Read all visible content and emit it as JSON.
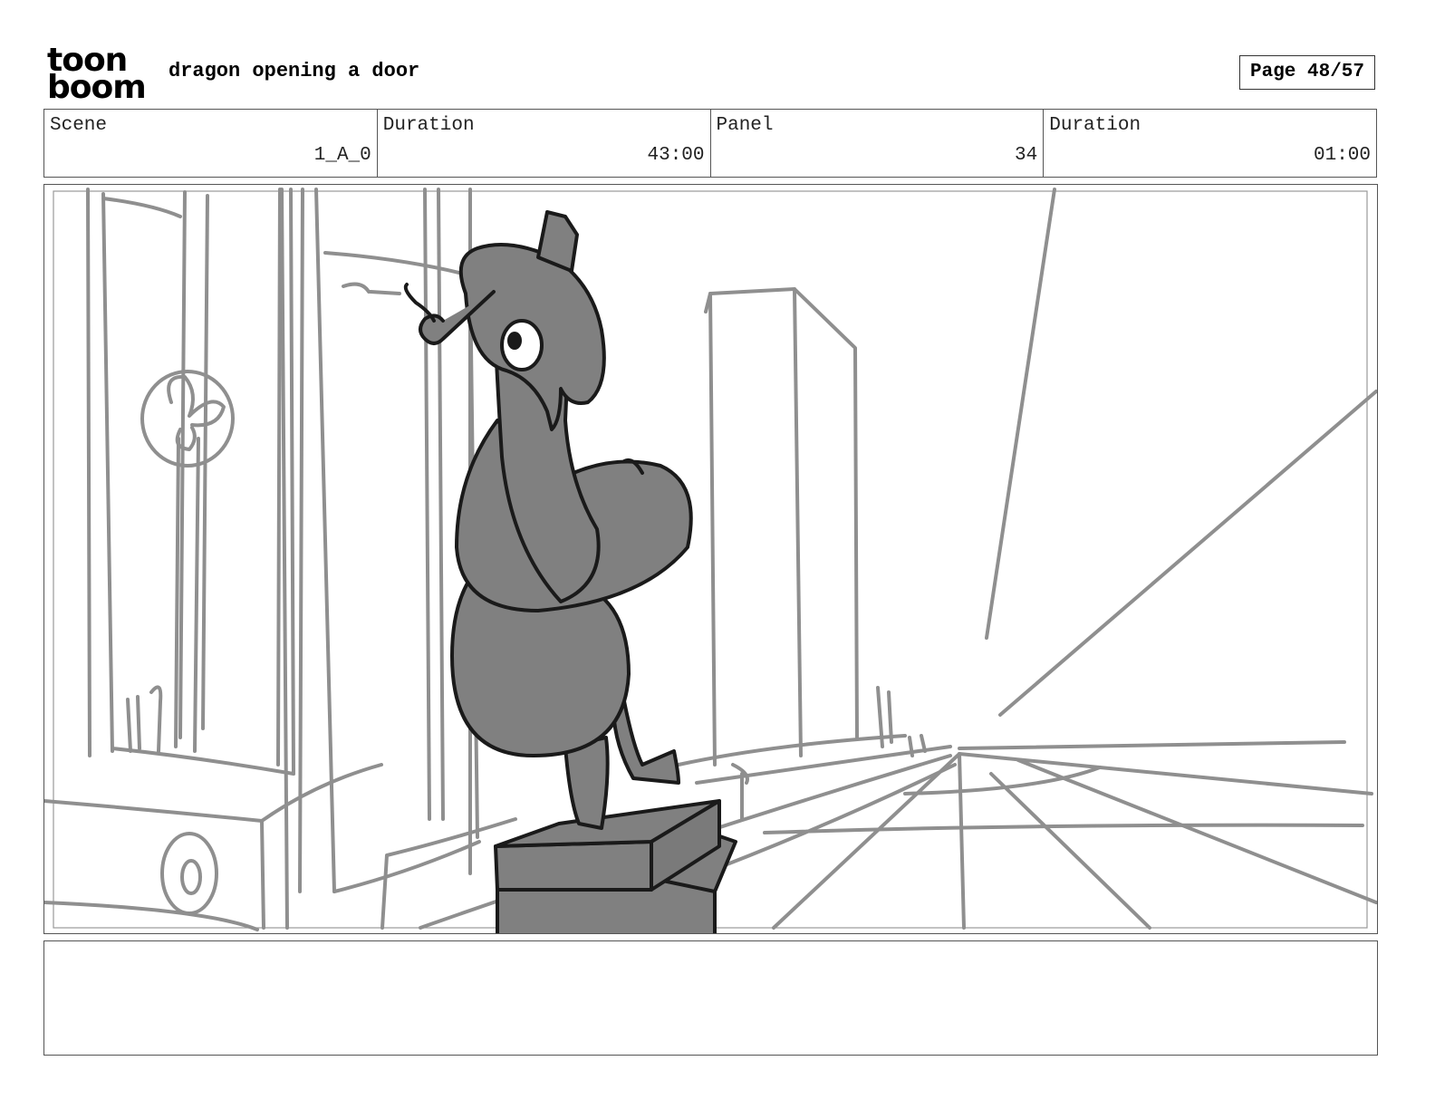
{
  "header": {
    "logo_line1": "toon",
    "logo_line2": "boom",
    "title": "dragon opening a door",
    "page": "Page 48/57"
  },
  "info": {
    "scene_label": "Scene",
    "scene_value": "1_A_0",
    "scene_duration_label": "Duration",
    "scene_duration_value": "43:00",
    "panel_label": "Panel",
    "panel_value": "34",
    "panel_duration_label": "Duration",
    "panel_duration_value": "01:00"
  },
  "panel_image": {
    "subject": "gray dragon statue on a pedestal reaching for a door handle",
    "colors": {
      "sketch_line": "#8f8f8f",
      "figure_fill": "#808080",
      "ink": "#1a1a1a"
    }
  },
  "notes": {
    "text": ""
  }
}
